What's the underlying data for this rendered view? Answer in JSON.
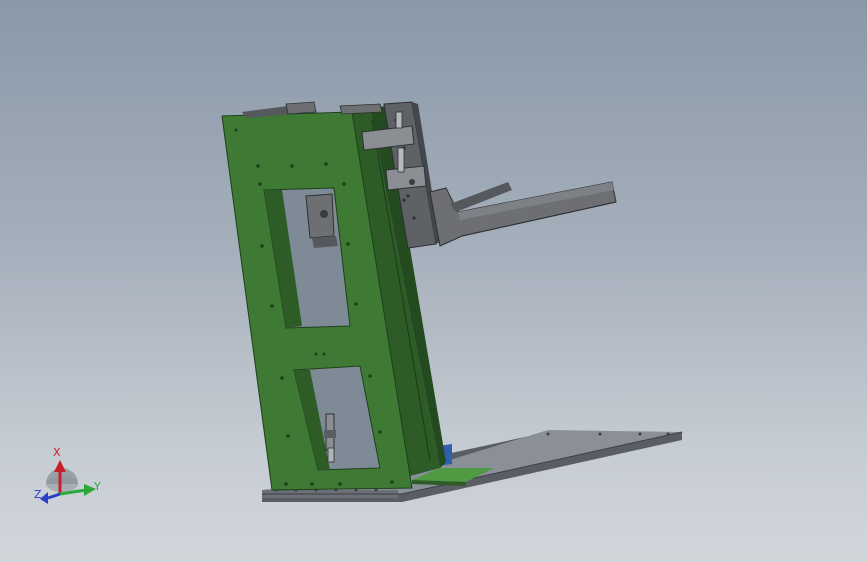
{
  "viewport": {
    "background_top": "#8a98a8",
    "background_bottom": "#d2d6db"
  },
  "model": {
    "frame_color": "#3f7a35",
    "frame_dark": "#2e5c27",
    "metal_color": "#6d6f73",
    "base_color": "#7b7f86",
    "accent_blue": "#2f5fb0"
  },
  "triad": {
    "x_label": "X",
    "y_label": "Y",
    "z_label": "Z",
    "x_color": "#c8202a",
    "y_color": "#2aa83a",
    "z_color": "#2a3fc8"
  }
}
